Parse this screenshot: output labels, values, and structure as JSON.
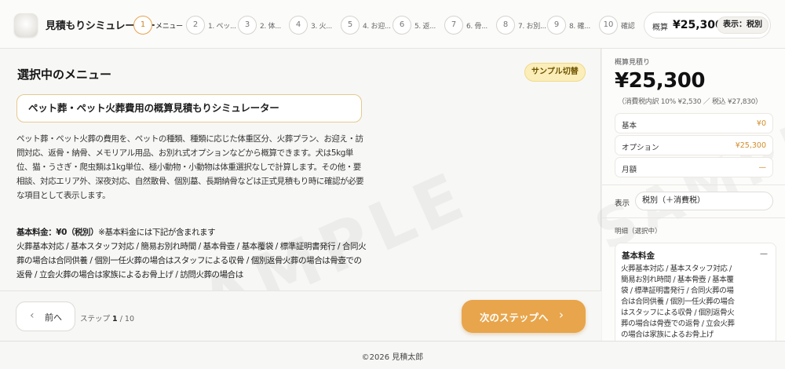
{
  "header": {
    "app_title": "見積もりシミュレーター",
    "steps": [
      {
        "num": "1",
        "label": "メニュー"
      },
      {
        "num": "2",
        "label": "1. ペッ..."
      },
      {
        "num": "3",
        "label": "2. 体..."
      },
      {
        "num": "4",
        "label": "3. 火..."
      },
      {
        "num": "5",
        "label": "4. お迎..."
      },
      {
        "num": "6",
        "label": "5. 返..."
      },
      {
        "num": "7",
        "label": "6. 骨..."
      },
      {
        "num": "8",
        "label": "7. お別..."
      },
      {
        "num": "9",
        "label": "8. 確..."
      },
      {
        "num": "10",
        "label": "確認"
      }
    ],
    "summary_label": "概算",
    "summary_value": "¥25,300",
    "tax_display": "表示：税別"
  },
  "main": {
    "section_title": "選択中のメニュー",
    "sample_button": "サンプル切替",
    "selected_menu": "ペット葬・ペット火葬費用の概算見積もりシミュレーター",
    "description": "ペット葬・ペット火葬の費用を、ペットの種類、種類に応じた体重区分、火葬プラン、お迎え・訪問対応、返骨・納骨、メモリアル用品、お別れ式オプションなどから概算できます。犬は5kg単位、猫・うさぎ・爬虫類は1kg単位、極小動物・小動物は体重選択なしで計算します。その他・要相談、対応エリア外、深夜対応、自然散骨、個別墓、長期納骨などは正式見積もり時に確認が必要な項目として表示します。",
    "base_fee_title": "基本料金：¥0（税別）",
    "base_fee_note": "※基本料金には下記が含まれます",
    "base_fee_items": "火葬基本対応 / 基本スタッフ対応 / 簡易お別れ時間 / 基本骨壺 / 基本覆袋 / 標準証明書発行 / 合同火葬の場合は合同供養 / 個別一任火葬の場合はスタッフによる収骨 / 個別返骨火葬の場合は骨壺での返骨 / 立会火葬の場合は家族によるお骨上げ / 訪問火葬の場合は"
  },
  "nav": {
    "back_label": "前へ",
    "step_prefix": "ステップ",
    "step_current": "1",
    "step_total": "/ 10",
    "next_label": "次のステップへ"
  },
  "sidebar": {
    "estimate_label": "概算見積り",
    "total": "¥25,300",
    "tax_line": "（消費税内訳 10% ¥2,530 ／ 税込 ¥27,830）",
    "rows": [
      {
        "label": "基本",
        "value": "¥0"
      },
      {
        "label": "オプション",
        "value": "¥25,300"
      },
      {
        "label": "月額",
        "value": "—"
      }
    ],
    "display_label": "表示",
    "display_value": "税別（＋消費税）",
    "detail_label": "明細（選択中）",
    "detail_title": "基本料金",
    "detail_dash": "—",
    "detail_body": "火葬基本対応 / 基本スタッフ対応 / 簡易お別れ時間 / 基本骨壺 / 基本覆袋 / 標準証明書発行 / 合同火葬の場合は合同供養 / 個別一任火葬の場合はスタッフによる収骨 / 個別返骨火葬の場合は骨壺での返骨 / 立会火葬の場合は家族によるお骨上げ"
  },
  "footer": {
    "copyright": "©2026 見積太郎"
  },
  "watermark": "SAMPLE",
  "colors": {
    "accent": "#e8a54b",
    "accent_text": "#d18d2a",
    "sample_chip": "#fbeeb9"
  }
}
